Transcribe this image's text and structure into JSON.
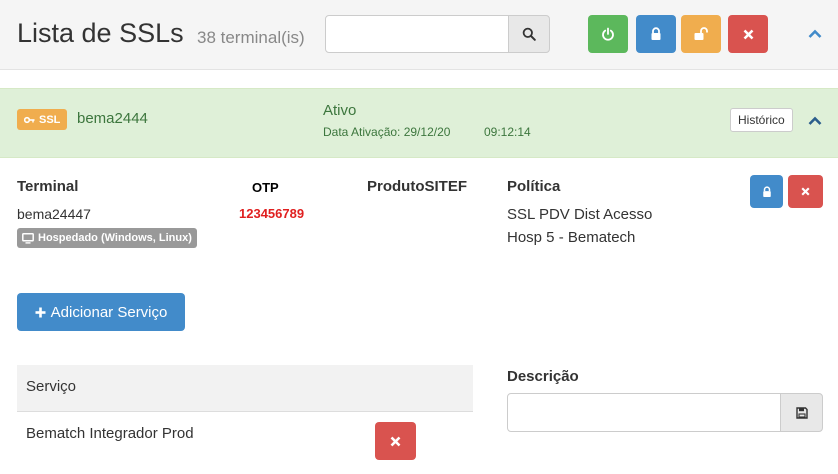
{
  "header": {
    "title": "Lista de SSLs",
    "count": "38 terminal(is)",
    "search": {
      "value": "",
      "placeholder": ""
    },
    "icons": {
      "search": "search-icon",
      "power": "power-icon",
      "lock": "lock-icon",
      "unlock": "unlock-icon",
      "remove": "times-icon",
      "collapse": "chevron-up-icon"
    },
    "colors": {
      "success": "#5cb85c",
      "primary": "#428bca",
      "warning": "#f0ad4e",
      "danger": "#d9534f"
    }
  },
  "ssl": {
    "badge": "SSL",
    "name": "bema2444",
    "status": "Ativo",
    "activation": "Data Ativação: 29/12/20",
    "time": "09:12:14",
    "history_label": "Histórico",
    "row_color": "#dff0d8"
  },
  "details": {
    "terminal_head": "Terminal",
    "otp_head": "OTP",
    "produto_head": "ProdutoSITEF",
    "politica_head": "Política",
    "terminal_value": "bema24447",
    "otp_value": "123456789",
    "hosted_badge": "Hospedado (Windows, Linux)",
    "policy_line1": "SSL PDV Dist Acesso",
    "policy_line2": "Hosp 5 - Bematech"
  },
  "add_service_label": "Adicionar Serviço",
  "services": {
    "column_head": "Serviço",
    "rows": [
      "Bematch Integrador Prod"
    ]
  },
  "description": {
    "label": "Descrição",
    "value": "",
    "placeholder": ""
  }
}
